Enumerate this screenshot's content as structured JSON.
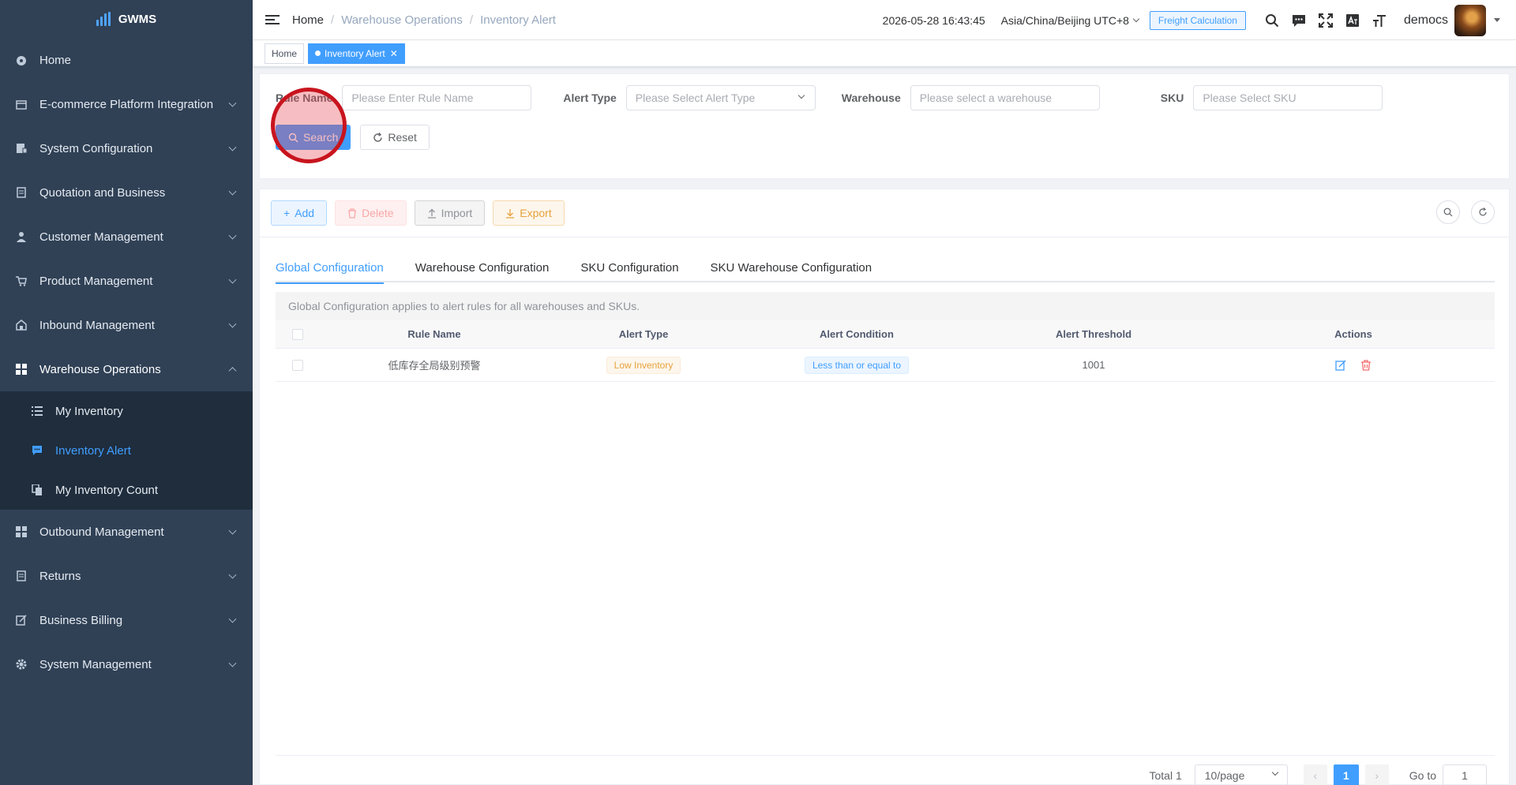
{
  "app": {
    "brand": "GWMS"
  },
  "colors": {
    "sidebar_bg": "#304156",
    "accent": "#409eff",
    "warning": "#e6a23c",
    "danger": "#f56c6c"
  },
  "sidebar": {
    "items": [
      {
        "label": "Home",
        "icon": "dashboard-icon",
        "expandable": false
      },
      {
        "label": "E-commerce Platform Integration",
        "icon": "store-icon",
        "expandable": true
      },
      {
        "label": "System Configuration",
        "icon": "config-icon",
        "expandable": true
      },
      {
        "label": "Quotation and Business",
        "icon": "document-icon",
        "expandable": true
      },
      {
        "label": "Customer Management",
        "icon": "user-icon",
        "expandable": true
      },
      {
        "label": "Product Management",
        "icon": "cart-icon",
        "expandable": true
      },
      {
        "label": "Inbound Management",
        "icon": "warehouse-icon",
        "expandable": true
      },
      {
        "label": "Warehouse Operations",
        "icon": "grid-icon",
        "expandable": true,
        "open": true
      },
      {
        "label": "Outbound Management",
        "icon": "grid-icon",
        "expandable": true
      },
      {
        "label": "Returns",
        "icon": "document-icon",
        "expandable": true
      },
      {
        "label": "Business Billing",
        "icon": "edit-icon",
        "expandable": true
      },
      {
        "label": "System Management",
        "icon": "gear-icon",
        "expandable": true
      }
    ],
    "warehouse_submenu": [
      {
        "label": "My Inventory",
        "icon": "list-icon"
      },
      {
        "label": "Inventory Alert",
        "icon": "message-icon",
        "active": true
      },
      {
        "label": "My Inventory Count",
        "icon": "copy-icon"
      }
    ]
  },
  "header": {
    "breadcrumb": [
      "Home",
      "Warehouse Operations",
      "Inventory Alert"
    ],
    "datetime": "2026-05-28 16:43:45",
    "timezone": "Asia/China/Beijing UTC+8",
    "freight_button": "Freight Calculation",
    "username": "democs"
  },
  "tags": [
    {
      "label": "Home",
      "active": false
    },
    {
      "label": "Inventory Alert",
      "active": true
    }
  ],
  "search_form": {
    "rule_name": {
      "label": "Rule Name",
      "placeholder": "Please Enter Rule Name",
      "value": ""
    },
    "alert_type": {
      "label": "Alert Type",
      "placeholder": "Please Select Alert Type",
      "value": ""
    },
    "warehouse": {
      "label": "Warehouse",
      "placeholder": "Please select a warehouse",
      "value": ""
    },
    "sku": {
      "label": "SKU",
      "placeholder": "Please Select SKU",
      "value": ""
    },
    "search_button": "Search",
    "reset_button": "Reset"
  },
  "toolbar": {
    "add": "Add",
    "delete": "Delete",
    "import": "Import",
    "export": "Export"
  },
  "tabs": [
    {
      "label": "Global Configuration",
      "active": true
    },
    {
      "label": "Warehouse Configuration",
      "active": false
    },
    {
      "label": "SKU Configuration",
      "active": false
    },
    {
      "label": "SKU Warehouse Configuration",
      "active": false
    }
  ],
  "info_text": "Global Configuration applies to alert rules for all warehouses and SKUs.",
  "table": {
    "columns": [
      "Rule Name",
      "Alert Type",
      "Alert Condition",
      "Alert Threshold",
      "Actions"
    ],
    "rows": [
      {
        "rule_name": "低库存全局级别预警",
        "alert_type": "Low Inventory",
        "alert_condition": "Less than or equal to",
        "alert_threshold": "1001"
      }
    ]
  },
  "pagination": {
    "total": "Total 1",
    "page_size": "10/page",
    "current_page": "1",
    "goto_label": "Go to",
    "goto_value": "1"
  }
}
